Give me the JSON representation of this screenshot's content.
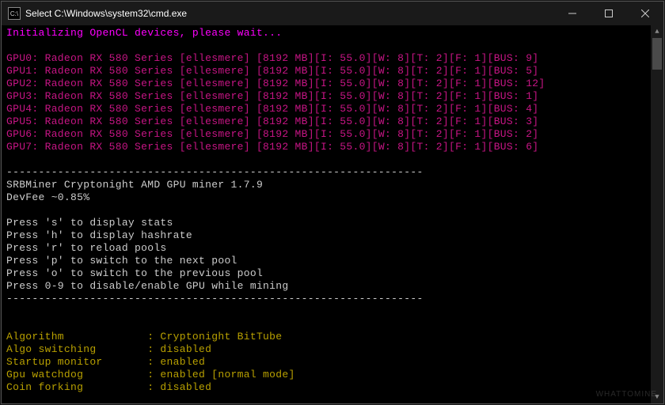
{
  "window": {
    "icon_text": "C:\\",
    "title": "Select C:\\Windows\\system32\\cmd.exe"
  },
  "init_line": "Initializing OpenCL devices, please wait...",
  "gpus": [
    {
      "idx": 0,
      "name": "Radeon RX 580 Series",
      "codename": "ellesmere",
      "mem": 8192,
      "i": "55.0",
      "w": 8,
      "t": 2,
      "f": 1,
      "bus": 9
    },
    {
      "idx": 1,
      "name": "Radeon RX 580 Series",
      "codename": "ellesmere",
      "mem": 8192,
      "i": "55.0",
      "w": 8,
      "t": 2,
      "f": 1,
      "bus": 5
    },
    {
      "idx": 2,
      "name": "Radeon RX 580 Series",
      "codename": "ellesmere",
      "mem": 8192,
      "i": "55.0",
      "w": 8,
      "t": 2,
      "f": 1,
      "bus": 12
    },
    {
      "idx": 3,
      "name": "Radeon RX 580 Series",
      "codename": "ellesmere",
      "mem": 8192,
      "i": "55.0",
      "w": 8,
      "t": 2,
      "f": 1,
      "bus": 1
    },
    {
      "idx": 4,
      "name": "Radeon RX 580 Series",
      "codename": "ellesmere",
      "mem": 8192,
      "i": "55.0",
      "w": 8,
      "t": 2,
      "f": 1,
      "bus": 4
    },
    {
      "idx": 5,
      "name": "Radeon RX 580 Series",
      "codename": "ellesmere",
      "mem": 8192,
      "i": "55.0",
      "w": 8,
      "t": 2,
      "f": 1,
      "bus": 3
    },
    {
      "idx": 6,
      "name": "Radeon RX 580 Series",
      "codename": "ellesmere",
      "mem": 8192,
      "i": "55.0",
      "w": 8,
      "t": 2,
      "f": 1,
      "bus": 2
    },
    {
      "idx": 7,
      "name": "Radeon RX 580 Series",
      "codename": "ellesmere",
      "mem": 8192,
      "i": "55.0",
      "w": 8,
      "t": 2,
      "f": 1,
      "bus": 6
    }
  ],
  "dash": "-----------------------------------------------------------------",
  "miner_name": "SRBMiner Cryptonight AMD GPU miner 1.7.9",
  "devfee": "DevFee ~0.85%",
  "keys": [
    "Press 's' to display stats",
    "Press 'h' to display hashrate",
    "Press 'r' to reload pools",
    "Press 'p' to switch to the next pool",
    "Press 'o' to switch to the previous pool",
    "Press 0-9 to disable/enable GPU while mining"
  ],
  "settings": [
    {
      "label": "Algorithm",
      "value": "Cryptonight BitTube"
    },
    {
      "label": "Algo switching",
      "value": "disabled"
    },
    {
      "label": "Startup monitor",
      "value": "enabled"
    },
    {
      "label": "Gpu watchdog",
      "value": "enabled [normal mode]"
    },
    {
      "label": "Coin forking",
      "value": "disabled"
    }
  ],
  "watermark": "WHATTOMINE"
}
